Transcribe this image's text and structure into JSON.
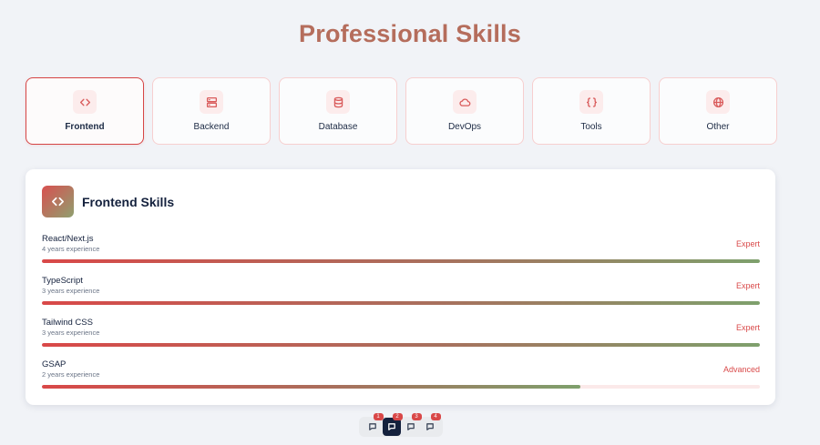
{
  "page": {
    "title": "Professional Skills"
  },
  "tabs": [
    {
      "label": "Frontend",
      "icon": "code-icon",
      "active": true
    },
    {
      "label": "Backend",
      "icon": "server-icon",
      "active": false
    },
    {
      "label": "Database",
      "icon": "database-icon",
      "active": false
    },
    {
      "label": "DevOps",
      "icon": "cloud-icon",
      "active": false
    },
    {
      "label": "Tools",
      "icon": "braces-icon",
      "active": false
    },
    {
      "label": "Other",
      "icon": "globe-icon",
      "active": false
    }
  ],
  "panel": {
    "title": "Frontend Skills",
    "icon": "code-icon",
    "skills": [
      {
        "name": "React/Next.js",
        "experience": "4 years experience",
        "level": "Expert",
        "progress": 1.0
      },
      {
        "name": "TypeScript",
        "experience": "3 years experience",
        "level": "Expert",
        "progress": 1.0
      },
      {
        "name": "Tailwind CSS",
        "experience": "3 years experience",
        "level": "Expert",
        "progress": 1.0
      },
      {
        "name": "GSAP",
        "experience": "2 years experience",
        "level": "Advanced",
        "progress": 0.75
      }
    ]
  },
  "pager": {
    "items": [
      {
        "badge": "1",
        "icon": "message-icon",
        "active": false
      },
      {
        "badge": "2",
        "icon": "message-icon",
        "active": true
      },
      {
        "badge": "3",
        "icon": "message-icon",
        "active": false
      },
      {
        "badge": "4",
        "icon": "message-icon",
        "active": false
      }
    ]
  },
  "colors": {
    "title": "#b56d5c",
    "accent": "#d94848",
    "gradient_end": "#7ea06c",
    "active_tab_border": "#d64545",
    "pager_active": "#14213d"
  }
}
